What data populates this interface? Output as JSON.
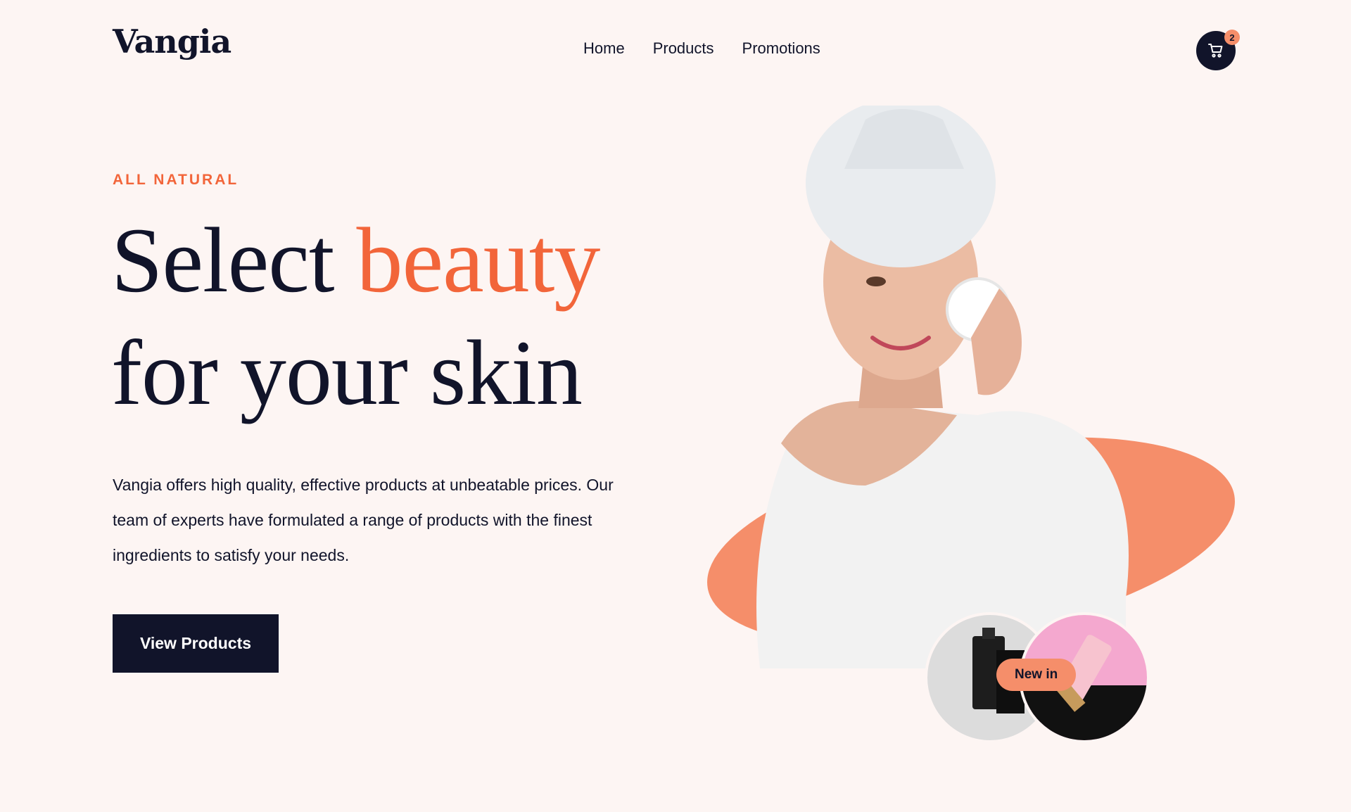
{
  "brand": {
    "logo": "Vangia"
  },
  "nav": {
    "items": [
      "Home",
      "Products",
      "Promotions"
    ]
  },
  "cart": {
    "count": "2",
    "icon": "cart-icon"
  },
  "hero": {
    "eyebrow": "ALL NATURAL",
    "headline_part1": "Select ",
    "headline_accent": "beauty",
    "headline_line2": "for your skin",
    "description": "Vangia offers high quality, effective products at unbeatable prices. Our team of experts have formulated a range of products with the finest ingredients to satisfy your needs.",
    "cta_label": "View Products",
    "badge": "New in"
  },
  "colors": {
    "accent": "#f2653a",
    "blob": "#f58e6a",
    "dark": "#11142a",
    "background": "#fdf5f3"
  }
}
